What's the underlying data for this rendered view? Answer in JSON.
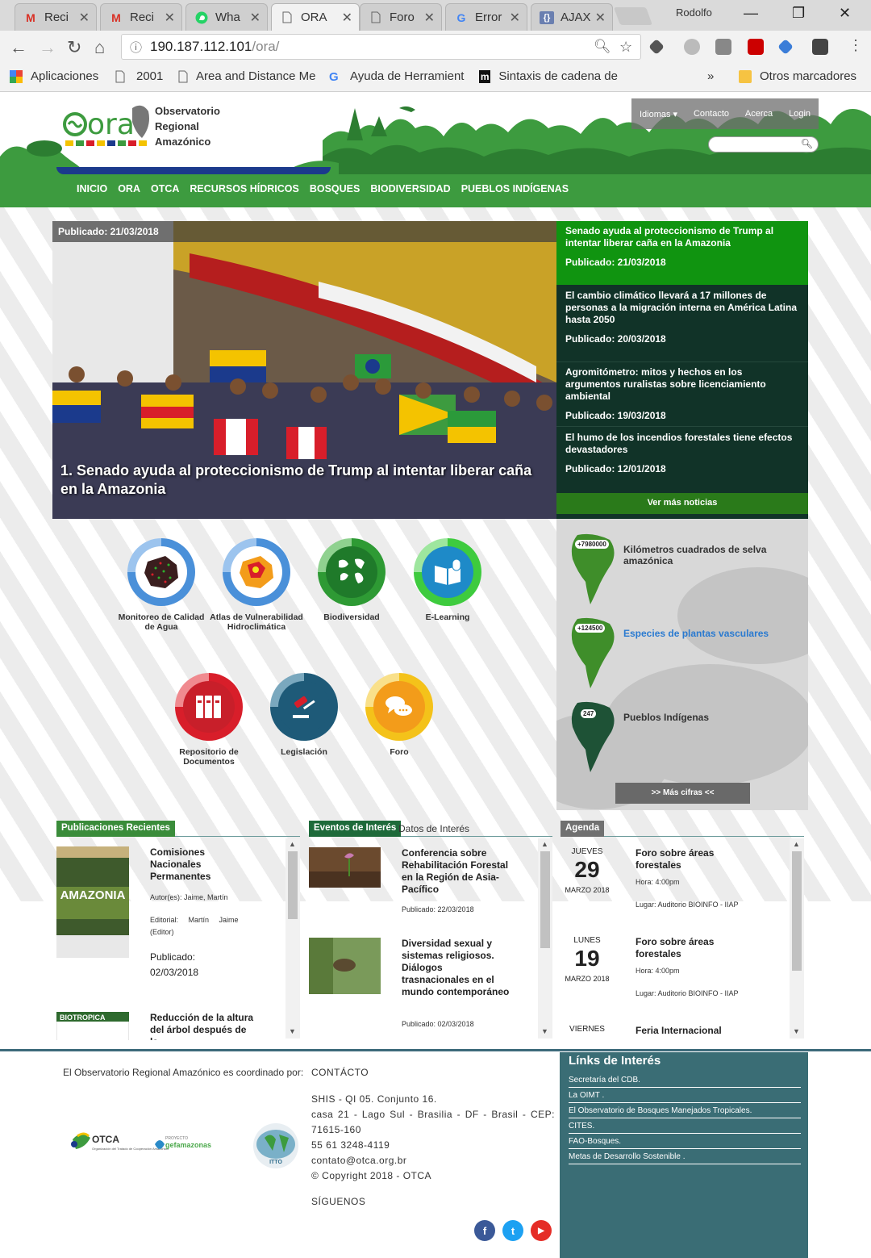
{
  "browser": {
    "tabs": [
      {
        "label": "Reci",
        "icon": "gmail-icon"
      },
      {
        "label": "Reci",
        "icon": "gmail-icon"
      },
      {
        "label": "Wha",
        "icon": "whatsapp-icon"
      },
      {
        "label": "ORA",
        "icon": "page-icon",
        "active": true
      },
      {
        "label": "Foro",
        "icon": "page-icon"
      },
      {
        "label": "Error",
        "icon": "google-icon"
      },
      {
        "label": "AJAX",
        "icon": "brackets-icon"
      }
    ],
    "profile_name": "Rodolfo",
    "url_host": "190.187.112.101",
    "url_path": "/ora/",
    "bookmarks": [
      {
        "label": "Aplicaciones",
        "icon": "apps-icon"
      },
      {
        "label": "2001",
        "icon": "page-icon"
      },
      {
        "label": "Area and Distance Me",
        "icon": "page-icon"
      },
      {
        "label": "Ayuda de Herramient",
        "icon": "google-icon"
      },
      {
        "label": "Sintaxis de cadena de",
        "icon": "m-icon"
      }
    ],
    "more_bookmarks": "»",
    "other_bookmarks": "Otros marcadores"
  },
  "header": {
    "logo_word": "ora",
    "site_name_lines": [
      "Observatorio",
      "Regional",
      "Amazónico"
    ],
    "top_menu": [
      "Idiomas ▾",
      "Contacto",
      "Acerca",
      "Login"
    ],
    "nav": [
      "INICIO",
      "ORA",
      "OTCA",
      "RECURSOS HÍDRICOS",
      "BOSQUES",
      "BIODIVERSIDAD",
      "PUEBLOS INDÍGENAS"
    ]
  },
  "hero": {
    "date": "Publicado: 21/03/2018",
    "title": "1. Senado ayuda al proteccionismo de Trump al intentar liberar caña en la Amazonia"
  },
  "news": [
    {
      "title": "Senado ayuda al proteccionismo de Trump al intentar liberar caña en la Amazonia",
      "date": "Publicado: 21/03/2018"
    },
    {
      "title": "El cambio climático llevará a 17 millones de personas a la migración interna en América Latina hasta 2050",
      "date": "Publicado: 20/03/2018"
    },
    {
      "title": "Agromitómetro: mitos y hechos en los argumentos ruralistas sobre licenciamiento ambiental",
      "date": "Publicado: 19/03/2018"
    },
    {
      "title": "El humo de los incendios forestales tiene efectos devastadores",
      "date": "Publicado: 12/01/2018"
    }
  ],
  "ver_mas": "Ver más noticias",
  "modules": [
    {
      "label": "Monitoreo de Calidad de Agua",
      "icon": "water-quality-map-icon",
      "ring": "#4a90d9",
      "inner": "#ffffff"
    },
    {
      "label": "Atlas de Vulnerabilidad Hidroclimática",
      "icon": "vulnerability-map-icon",
      "ring": "#4a90d9",
      "inner": "#ffffff"
    },
    {
      "label": "Biodiversidad",
      "icon": "biodiversity-icon",
      "ring": "#2e9a34",
      "inner": "#1f7a2a"
    },
    {
      "label": "E-Learning",
      "icon": "elearning-icon",
      "ring": "#3ecb3e",
      "inner": "#1e8ac8"
    },
    {
      "label": "Repositorio de Documentos",
      "icon": "documents-icon",
      "ring": "#d81e2a",
      "inner": "#c81f2a"
    },
    {
      "label": "Legislación",
      "icon": "gavel-icon",
      "ring": "#1e5a78",
      "inner": "#1e5a78"
    },
    {
      "label": "Foro",
      "icon": "chat-icon",
      "ring": "#f4c21a",
      "inner": "#f39c1a"
    }
  ],
  "cifras": [
    {
      "num": "+7980000",
      "label": "Kilómetros cuadrados de selva amazónica",
      "map_color": "#3f8e2a",
      "link": false
    },
    {
      "num": "+124500",
      "label": "Especies de plantas vasculares",
      "map_color": "#3f8e2a",
      "link": true
    },
    {
      "num": "247",
      "label": "Pueblos Indígenas",
      "map_color": "#1e5236",
      "link": false
    }
  ],
  "mas_cifras": ">> Más cifras <<",
  "publicaciones": {
    "header": "Publicaciones Recientes",
    "items": [
      {
        "title": "Comisiones Nacionales Permanentes",
        "autor": "Autor(es): Jaime, Martín",
        "editorial_1": "Editorial:     Martín     Jaime",
        "editorial_2": "(Editor)",
        "pub_label": "Publicado:",
        "pub_date": "02/03/2018",
        "cover_text": "AMAZONIA"
      },
      {
        "title": "Reducción de la altura del árbol después de la",
        "cover_text": "BIOTROPICA"
      }
    ]
  },
  "eventos": {
    "tab_active": "Eventos de Interés",
    "tab_inactive": "Datos de Interés",
    "items": [
      {
        "title": "Conferencia sobre Rehabilitación Forestal en la Región de Asia-Pacífico",
        "date": "Publicado: 22/03/2018"
      },
      {
        "title": "Diversidad sexual y sistemas religiosos. Diálogos trasnacionales en el mundo contemporáneo",
        "date": "Publicado: 02/03/2018"
      }
    ]
  },
  "agenda": {
    "header": "Agenda",
    "items": [
      {
        "weekday": "JUEVES",
        "day": "29",
        "month": "MARZO 2018",
        "title": "Foro sobre áreas forestales",
        "hora": "Hora: 4:00pm",
        "lugar": "Lugar: Auditorio BIOINFO - IIAP"
      },
      {
        "weekday": "LUNES",
        "day": "19",
        "month": "MARZO 2018",
        "title": "Foro sobre áreas forestales",
        "hora": "Hora: 4:00pm",
        "lugar": "Lugar: Auditorio BIOINFO - IIAP"
      },
      {
        "weekday": "VIERNES",
        "title": "Feria Internacional"
      }
    ]
  },
  "footer": {
    "coord_text": "El Observatorio Regional Amazónico es coordinado por:",
    "logos": [
      "OTCA",
      "Organización del Tratado de Cooperación Amazónica",
      "PROYECTO",
      "gefamazonas",
      "ITTO"
    ],
    "contact_title": "CONTÁCTO",
    "contact_lines": [
      "SHIS - QI 05. Conjunto 16.",
      "casa 21 - Lago Sul - Brasilia - DF - Brasil - CEP: 71615-160",
      "55 61 3248-4119",
      "contato@otca.org.br",
      "© Copyright 2018 - OTCA"
    ],
    "siguenos": "SÍGUENOS",
    "social": [
      {
        "name": "facebook",
        "glyph": "f",
        "color": "#3b5998"
      },
      {
        "name": "twitter",
        "glyph": "t",
        "color": "#1da1f2"
      },
      {
        "name": "youtube",
        "glyph": "▶",
        "color": "#e52d27"
      }
    ],
    "links_title": "Línks de Interés",
    "links": [
      "Secretaría del CDB.",
      "La OIMT .",
      "El Observatorio de Bosques Manejados Tropicales.",
      "CITES.",
      "FAO-Bosques.",
      "Metas de Desarrollo Sostenible ."
    ]
  }
}
